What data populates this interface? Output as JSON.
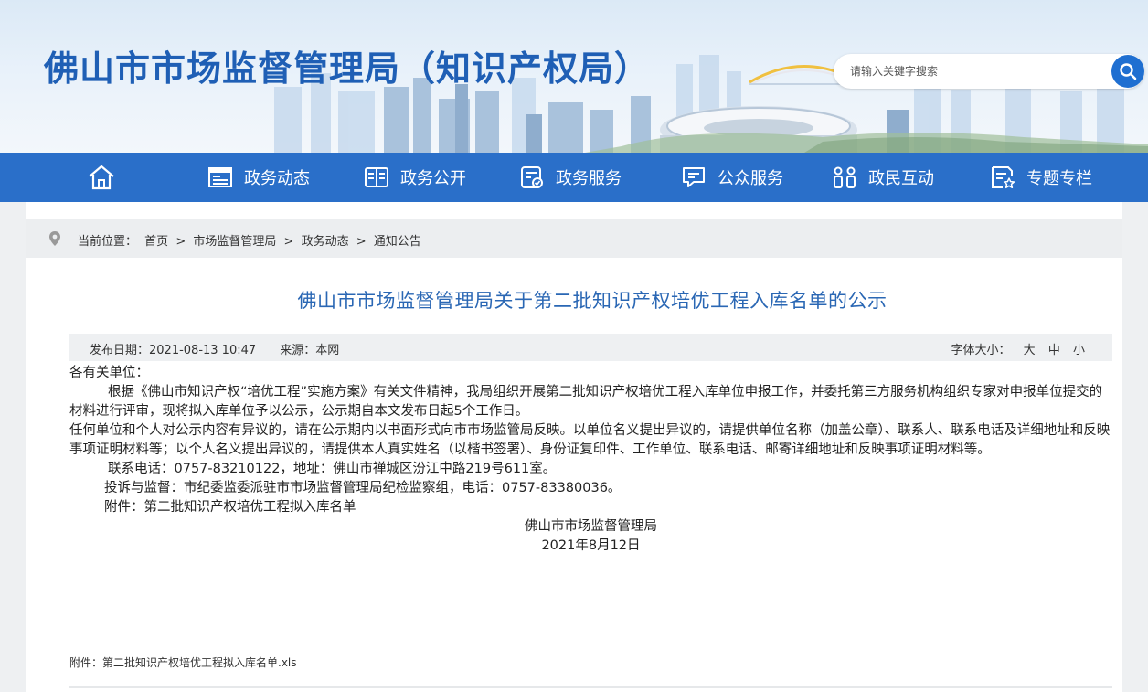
{
  "header": {
    "site_title": "佛山市市场监督管理局（知识产权局）",
    "search_placeholder": "请输入关键字搜索"
  },
  "nav": {
    "home_icon": "home-icon",
    "items": [
      {
        "label": "政务动态",
        "icon": "newspaper-icon"
      },
      {
        "label": "政务公开",
        "icon": "book-open-icon"
      },
      {
        "label": "政务服务",
        "icon": "service-check-icon"
      },
      {
        "label": "公众服务",
        "icon": "chat-bubble-icon"
      },
      {
        "label": "政民互动",
        "icon": "people-icon"
      },
      {
        "label": "专题专栏",
        "icon": "document-star-icon"
      }
    ]
  },
  "breadcrumb": {
    "prefix": "当前位置：",
    "items": [
      "首页",
      "市场监督管理局",
      "政务动态",
      "通知公告"
    ],
    "separator": ">"
  },
  "article": {
    "title": "佛山市市场监督管理局关于第二批知识产权培优工程入库名单的公示",
    "publish_label": "发布日期：2021-08-13 10:47",
    "source_label": "来源：本网",
    "font_size_label": "字体大小：",
    "font_sizes": [
      "大",
      "中",
      "小"
    ],
    "paragraphs": {
      "p1": "各有关单位：",
      "p2": "根据《佛山市知识产权“培优工程”实施方案》有关文件精神，我局组织开展第二批知识产权培优工程入库单位申报工作，并委托第三方服务机构组织专家对申报单位提交的材料进行评审，现将拟入库单位予以公示，公示期自本文发布日起5个工作日。",
      "p3": "任何单位和个人对公示内容有异议的，请在公示期内以书面形式向市市场监管局反映。以单位名义提出异议的，请提供单位名称（加盖公章）、联系人、联系电话及详细地址和反映事项证明材料等；以个人名义提出异议的，请提供本人真实姓名（以楷书签署）、身份证复印件、工作单位、联系电话、邮寄详细地址和反映事项证明材料等。",
      "p4": "联系电话：0757-83210122，地址：佛山市禅城区汾江中路219号611室。",
      "p5": "投诉与监督：市纪委监委派驻市市场监督管理局纪检监察组，电话：0757-83380036。",
      "p6": "附件：第二批知识产权培优工程拟入库名单",
      "sign_org": "佛山市市场监督管理局",
      "sign_date": "2021年8月12日"
    },
    "attachment_link": "附件：第二批知识产权培优工程拟入库名单.xls"
  },
  "colors": {
    "brand_blue": "#2a6fc9",
    "title_blue": "#1f5fb5",
    "article_title_blue": "#2a67b4"
  }
}
